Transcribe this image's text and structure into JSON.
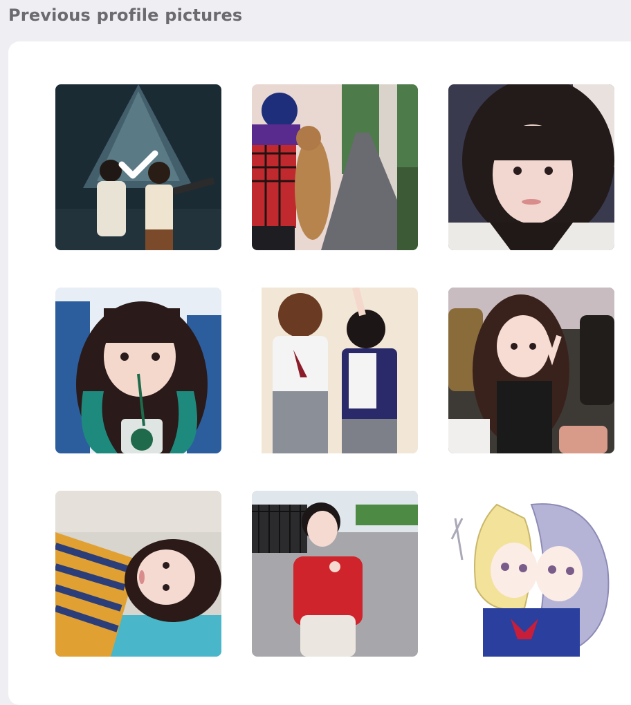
{
  "page": {
    "section_title": "Previous profile pictures"
  },
  "pictures": [
    {
      "id": "selfie-dark-stage",
      "selected": true,
      "description_icon": "photo-icon"
    },
    {
      "id": "purple-scarf-cat",
      "selected": false,
      "description_icon": "photo-icon"
    },
    {
      "id": "closeup-bangs",
      "selected": false,
      "description_icon": "photo-icon"
    },
    {
      "id": "train-seat-drink",
      "selected": false,
      "description_icon": "photo-icon"
    },
    {
      "id": "school-uniforms",
      "selected": false,
      "description_icon": "photo-icon"
    },
    {
      "id": "bus-peace-sign",
      "selected": false,
      "description_icon": "photo-icon"
    },
    {
      "id": "lying-striped-top",
      "selected": false,
      "description_icon": "photo-icon"
    },
    {
      "id": "red-sweater-street",
      "selected": false,
      "description_icon": "photo-icon"
    },
    {
      "id": "anime-drawing",
      "selected": false,
      "description_icon": "photo-icon"
    }
  ],
  "colors": {
    "page_bg": "#efeef3",
    "card_bg": "#ffffff",
    "title": "#6b6b6f",
    "check": "#ffffff"
  }
}
